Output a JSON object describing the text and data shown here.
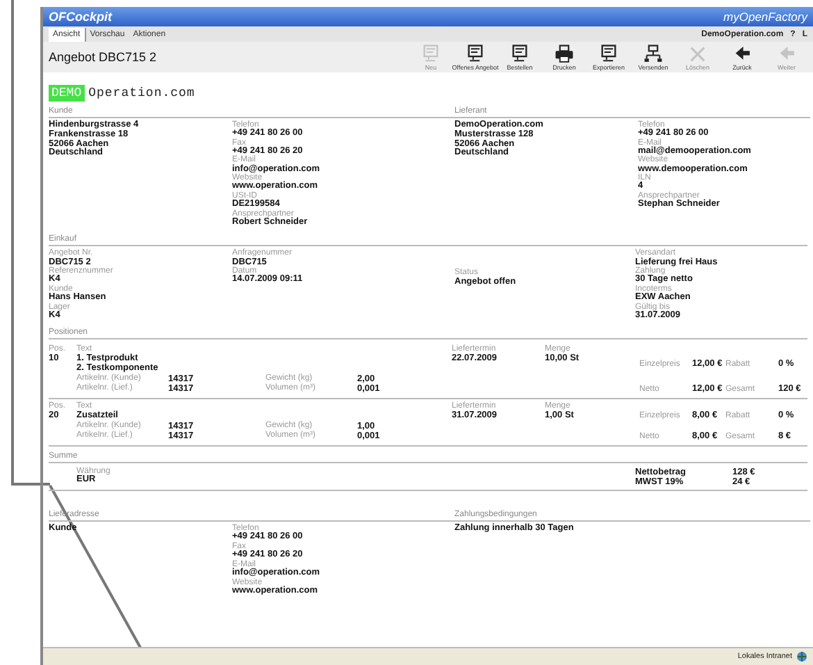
{
  "window": {
    "title": "OFCockpit",
    "brand": "myOpenFactory"
  },
  "menu": [
    {
      "label": "Ansicht",
      "selected": true
    },
    {
      "label": "Vorschau",
      "selected": false
    },
    {
      "label": "Aktionen",
      "selected": false
    }
  ],
  "account": {
    "user": "DemoOperation.com",
    "help": "?",
    "logout": "L"
  },
  "document": {
    "title": "Angebot DBC715 2"
  },
  "toolbar": [
    {
      "label": "Neu",
      "kind": "document",
      "disabled": true
    },
    {
      "label": "Offenes Angebot",
      "kind": "document",
      "disabled": false
    },
    {
      "label": "Bestellen",
      "kind": "document",
      "disabled": false
    },
    {
      "label": "Drucken",
      "kind": "printer",
      "disabled": false
    },
    {
      "label": "Exportieren",
      "kind": "document",
      "disabled": false
    },
    {
      "label": "Versenden",
      "kind": "network",
      "disabled": false
    },
    {
      "label": "Löschen",
      "kind": "cross",
      "disabled": true
    },
    {
      "label": "Zurück",
      "kind": "arrow",
      "disabled": false
    },
    {
      "label": "Weiter",
      "kind": "arrow",
      "disabled": true
    }
  ],
  "company": {
    "badge": "DEMO",
    "name": "Operation.com"
  },
  "parties": [
    {
      "title": "Kunde",
      "address": [
        "Hindenburgstrasse 4",
        "Frankenstrasse 18",
        "52066 Aachen",
        "Deutschland"
      ],
      "fields": [
        {
          "label": "Telefon",
          "value": "+49 241 80 26 00"
        },
        {
          "label": "Fax",
          "value": "+49 241 80 26 20"
        },
        {
          "label": "E-Mail",
          "value": "info@operation.com"
        },
        {
          "label": "Website",
          "value": "www.operation.com"
        },
        {
          "label": "USt-ID",
          "value": "DE2199584"
        },
        {
          "label": "Ansprechpartner",
          "value": "Robert Schneider"
        }
      ]
    },
    {
      "title": "Lieferant",
      "address": [
        "DemoOperation.com",
        "Musterstrasse 128",
        "52066 Aachen",
        "Deutschland"
      ],
      "fields": [
        {
          "label": "Telefon",
          "value": "+49 241 80 26 00"
        },
        {
          "label": "E-Mail",
          "value": "mail@demooperation.com"
        },
        {
          "label": "Website",
          "value": "www.demooperation.com"
        },
        {
          "label": "ILN",
          "value": "4"
        },
        {
          "label": "Ansprechpartner",
          "value": "Stephan Schneider"
        }
      ]
    }
  ],
  "purchase": {
    "title": "Einkauf",
    "columns": [
      [
        {
          "label": "Angebot Nr.",
          "value": "DBC715 2"
        },
        {
          "label": "Referenznummer",
          "value": "K4"
        },
        {
          "label": "Kunde",
          "value": "Hans Hansen"
        },
        {
          "label": "Lager",
          "value": "K4"
        }
      ],
      [
        {
          "label": "Anfragenummer",
          "value": "DBC715"
        },
        {
          "label": "Datum",
          "value": "14.07.2009 09:11"
        }
      ],
      [
        {
          "label": "Status",
          "value": "Angebot offen"
        }
      ],
      [
        {
          "label": "Versandart",
          "value": "Lieferung frei Haus"
        },
        {
          "label": "Zahlung",
          "value": "30 Tage netto"
        },
        {
          "label": "Incoterms",
          "value": "EXW Aachen"
        },
        {
          "label": "Gültig bis",
          "value": "31.07.2009"
        }
      ]
    ]
  },
  "positions": {
    "title": "Positionen",
    "items": [
      {
        "number_label": "Pos.",
        "number": "10",
        "text_label": "Text",
        "lines": [
          "1. Testprodukt",
          "2. Testkomponente"
        ],
        "details": [
          {
            "label": "Artikelnr. (Kunde)",
            "value": "14317"
          },
          {
            "label": "Gewicht (kg)",
            "value": "2,00"
          },
          {
            "label": "Artikelnr. (Lief.)",
            "value": "14317"
          },
          {
            "label": "Volumen (m³)",
            "value": "0,001"
          }
        ],
        "date_label": "Liefertermin",
        "date": "22.07.2009",
        "qty_label": "Menge",
        "qty": "10,00 St",
        "prices": [
          {
            "label": "Einzelpreis",
            "value": "12,00 €"
          },
          {
            "label": "Rabatt",
            "value": "0 %"
          },
          {
            "label": "Netto",
            "value": "12,00 €"
          },
          {
            "label": "Gesamt",
            "value": "120 €"
          }
        ]
      },
      {
        "number_label": "Pos.",
        "number": "20",
        "text_label": "Text",
        "lines": [
          "Zusatzteil"
        ],
        "details": [
          {
            "label": "Artikelnr. (Kunde)",
            "value": "14317"
          },
          {
            "label": "Gewicht (kg)",
            "value": "1,00"
          },
          {
            "label": "Artikelnr. (Lief.)",
            "value": "14317"
          },
          {
            "label": "Volumen (m³)",
            "value": "0,001"
          }
        ],
        "date_label": "Liefertermin",
        "date": "31.07.2009",
        "qty_label": "Menge",
        "qty": "1,00 St",
        "prices": [
          {
            "label": "Einzelpreis",
            "value": "8,00 €"
          },
          {
            "label": "Rabatt",
            "value": "0 %"
          },
          {
            "label": "Netto",
            "value": "8,00 €"
          },
          {
            "label": "Gesamt",
            "value": "8 €"
          }
        ]
      }
    ]
  },
  "total": {
    "title": "Summe",
    "fields": [
      {
        "label": "Währung",
        "value": "EUR"
      }
    ],
    "lines": [
      {
        "label": "Nettobetrag",
        "value": "128 €"
      },
      {
        "label": "MWST 19%",
        "value": "24 €"
      }
    ]
  },
  "footer": [
    {
      "title": "Lieferadresse",
      "address": [
        "Kunde"
      ],
      "fields": [
        {
          "label": "Telefon",
          "value": "+49 241 80 26 00"
        },
        {
          "label": "Fax",
          "value": "+49 241 80 26 20"
        },
        {
          "label": "E-Mail",
          "value": "info@operation.com"
        },
        {
          "label": "Website",
          "value": "www.operation.com"
        }
      ]
    },
    {
      "title": "Zahlungsbedingungen",
      "address": [
        "Zahlung innerhalb 30 Tagen"
      ]
    }
  ],
  "status_bar": {
    "zone": "Lokales Intranet"
  }
}
